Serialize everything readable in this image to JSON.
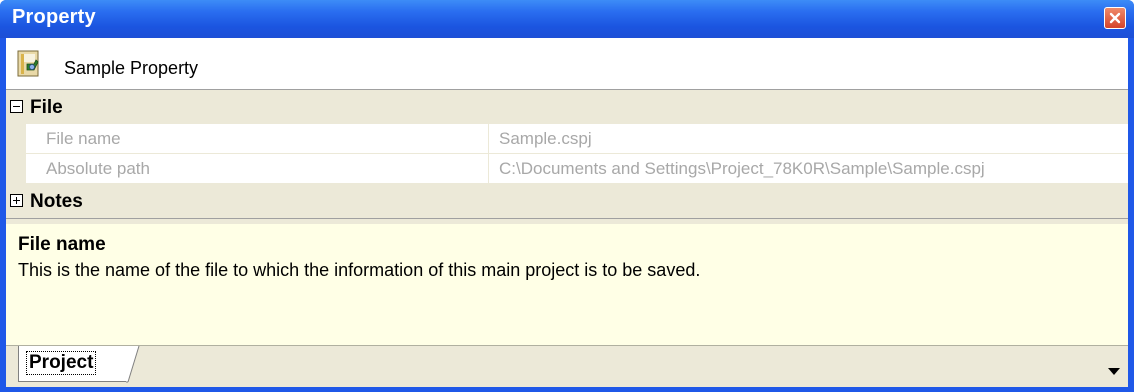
{
  "window": {
    "title": "Property",
    "close_icon": "close-icon"
  },
  "header": {
    "icon": "project-property-icon",
    "label": "Sample Property"
  },
  "grid": {
    "categories": [
      {
        "label": "File",
        "state": "expanded",
        "properties": [
          {
            "name": "File name",
            "value": "Sample.cspj"
          },
          {
            "name": "Absolute path",
            "value": "C:\\Documents and Settings\\Project_78K0R\\Sample\\Sample.cspj"
          }
        ]
      },
      {
        "label": "Notes",
        "state": "collapsed"
      }
    ]
  },
  "description": {
    "title": "File name",
    "text": "This is the name of the file to which the information of this main project is to be saved."
  },
  "tabs": {
    "items": [
      {
        "label": "Project",
        "selected": true
      }
    ],
    "dropdown_icon": "chevron-down-icon"
  },
  "colors": {
    "titlebar": "#1f58e8",
    "description_bg": "#ffffe6",
    "disabled_text": "#a8a8a8",
    "panel_bg": "#ece9d8"
  }
}
